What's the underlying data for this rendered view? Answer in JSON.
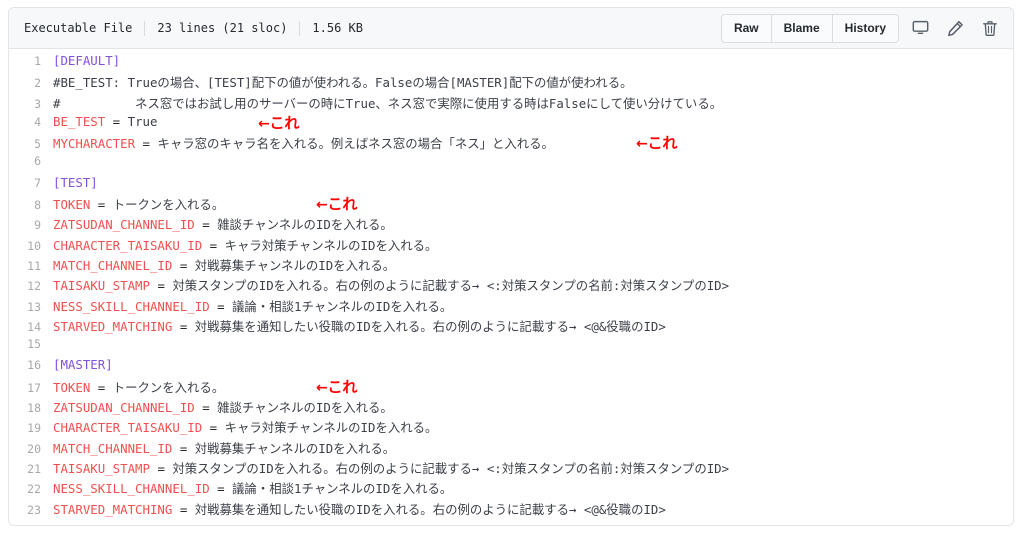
{
  "header": {
    "file_type": "Executable File",
    "lines_info": "23 lines (21 sloc)",
    "file_size": "1.56 KB",
    "buttons": [
      {
        "label": "Raw",
        "name": "raw-button"
      },
      {
        "label": "Blame",
        "name": "blame-button"
      },
      {
        "label": "History",
        "name": "history-button"
      }
    ],
    "icons": [
      {
        "name": "desktop-icon",
        "title": "Open in desktop"
      },
      {
        "name": "pencil-icon",
        "title": "Edit this file"
      },
      {
        "name": "trash-icon",
        "title": "Delete this file"
      }
    ]
  },
  "colors": {
    "section": "#8250df",
    "key": "#f0504f",
    "comment": "#3b4048",
    "annotation": "#fe0000",
    "border": "#e1e4e8",
    "header_bg": "#f6f8fa"
  },
  "annotation_text": "←これ",
  "code": {
    "lines": [
      {
        "n": "1",
        "type": "section",
        "text": "[DEFAULT]"
      },
      {
        "n": "2",
        "type": "comment",
        "text": "#BE_TEST: Trueの場合、[TEST]配下の値が使われる。Falseの場合[MASTER]配下の値が使われる。"
      },
      {
        "n": "3",
        "type": "comment",
        "text": "#          ネス窓ではお試し用のサーバーの時にTrue、ネス窓で実際に使用する時はFalseにして使い分けている。"
      },
      {
        "n": "4",
        "type": "pair",
        "key": "BE_TEST",
        "value": "True",
        "note": true
      },
      {
        "n": "5",
        "type": "pair",
        "key": "MYCHARACTER",
        "value": "キャラ窓のキャラ名を入れる。例えばネス窓の場合「ネス」と入れる。",
        "note": true
      },
      {
        "n": "6",
        "type": "blank",
        "text": ""
      },
      {
        "n": "7",
        "type": "section",
        "text": "[TEST]"
      },
      {
        "n": "8",
        "type": "pair",
        "key": "TOKEN",
        "value": "トークンを入れる。",
        "note": true
      },
      {
        "n": "9",
        "type": "pair",
        "key": "ZATSUDAN_CHANNEL_ID",
        "value": "雑談チャンネルのIDを入れる。",
        "note": false
      },
      {
        "n": "10",
        "type": "pair",
        "key": "CHARACTER_TAISAKU_ID",
        "value": "キャラ対策チャンネルのIDを入れる。",
        "note": false
      },
      {
        "n": "11",
        "type": "pair",
        "key": "MATCH_CHANNEL_ID",
        "value": "対戦募集チャンネルのIDを入れる。",
        "note": false
      },
      {
        "n": "12",
        "type": "pair",
        "key": "TAISAKU_STAMP",
        "value": "対策スタンプのIDを入れる。右の例のように記載する→ <:対策スタンプの名前:対策スタンプのID>",
        "note": false
      },
      {
        "n": "13",
        "type": "pair",
        "key": "NESS_SKILL_CHANNEL_ID",
        "value": "議論・相談1チャンネルのIDを入れる。",
        "note": false
      },
      {
        "n": "14",
        "type": "pair",
        "key": "STARVED_MATCHING",
        "value": "対戦募集を通知したい役職のIDを入れる。右の例のように記載する→ <@&役職のID>",
        "note": false
      },
      {
        "n": "15",
        "type": "blank",
        "text": ""
      },
      {
        "n": "16",
        "type": "section",
        "text": "[MASTER]"
      },
      {
        "n": "17",
        "type": "pair",
        "key": "TOKEN",
        "value": "トークンを入れる。",
        "note": true
      },
      {
        "n": "18",
        "type": "pair",
        "key": "ZATSUDAN_CHANNEL_ID",
        "value": "雑談チャンネルのIDを入れる。",
        "note": false
      },
      {
        "n": "19",
        "type": "pair",
        "key": "CHARACTER_TAISAKU_ID",
        "value": "キャラ対策チャンネルのIDを入れる。",
        "note": false
      },
      {
        "n": "20",
        "type": "pair",
        "key": "MATCH_CHANNEL_ID",
        "value": "対戦募集チャンネルのIDを入れる。",
        "note": false
      },
      {
        "n": "21",
        "type": "pair",
        "key": "TAISAKU_STAMP",
        "value": "対策スタンプのIDを入れる。右の例のように記載する→ <:対策スタンプの名前:対策スタンプのID>",
        "note": false
      },
      {
        "n": "22",
        "type": "pair",
        "key": "NESS_SKILL_CHANNEL_ID",
        "value": "議論・相談1チャンネルのIDを入れる。",
        "note": false
      },
      {
        "n": "23",
        "type": "pair",
        "key": "STARVED_MATCHING",
        "value": "対戦募集を通知したい役職のIDを入れる。右の例のように記載する→ <@&役職のID>",
        "note": false
      }
    ]
  }
}
